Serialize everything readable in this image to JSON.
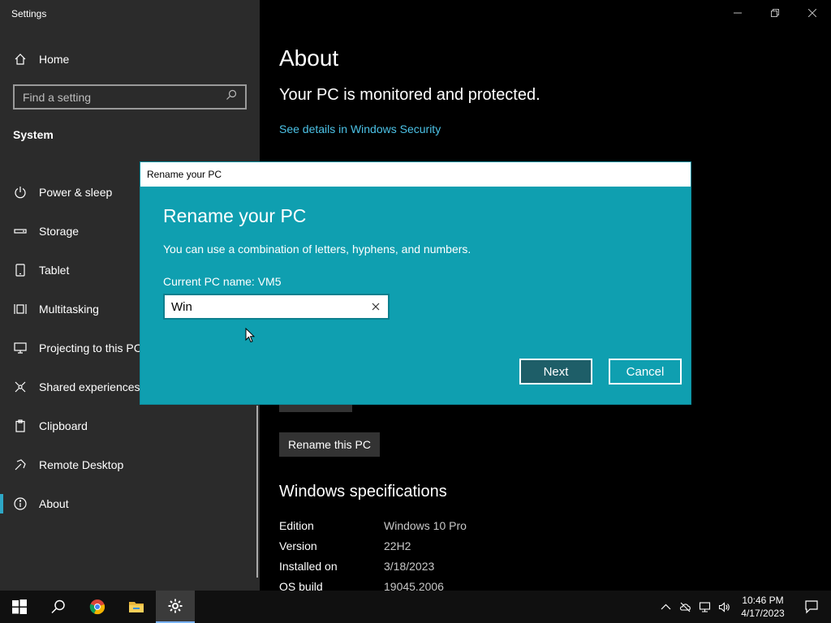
{
  "window": {
    "title": "Settings"
  },
  "sidebar": {
    "home_label": "Home",
    "search_placeholder": "Find a setting",
    "section_title": "System",
    "items": [
      {
        "label": "Power & sleep",
        "icon": "power-icon"
      },
      {
        "label": "Storage",
        "icon": "storage-icon"
      },
      {
        "label": "Tablet",
        "icon": "tablet-icon"
      },
      {
        "label": "Multitasking",
        "icon": "multitasking-icon"
      },
      {
        "label": "Projecting to this PC",
        "icon": "projecting-icon"
      },
      {
        "label": "Shared experiences",
        "icon": "shared-experiences-icon"
      },
      {
        "label": "Clipboard",
        "icon": "clipboard-icon"
      },
      {
        "label": "Remote Desktop",
        "icon": "remote-desktop-icon"
      },
      {
        "label": "About",
        "icon": "info-icon",
        "active": true
      }
    ]
  },
  "main": {
    "title": "About",
    "protection_text": "Your PC is monitored and protected.",
    "security_link": "See details in Windows Security",
    "rename_button": "Rename this PC",
    "spec_title": "Windows specifications",
    "specs": [
      {
        "key": "Edition",
        "value": "Windows 10 Pro"
      },
      {
        "key": "Version",
        "value": "22H2"
      },
      {
        "key": "Installed on",
        "value": "3/18/2023"
      },
      {
        "key": "OS build",
        "value": "19045.2006"
      }
    ]
  },
  "dialog": {
    "titlebar": "Rename your PC",
    "heading": "Rename your PC",
    "description": "You can use a combination of letters, hyphens, and numbers.",
    "current_name": "Current PC name: VM5",
    "input_value": "Win",
    "next_label": "Next",
    "cancel_label": "Cancel"
  },
  "taskbar": {
    "apps": [
      "start-icon",
      "search-icon",
      "chrome-icon",
      "file-explorer-icon",
      "settings-icon"
    ],
    "clock_time": "10:46 PM",
    "clock_date": "4/17/2023"
  },
  "colors": {
    "accent": "#0f9fb0",
    "link": "#4cc2e6",
    "sidebar_bg": "#2b2b2b"
  }
}
